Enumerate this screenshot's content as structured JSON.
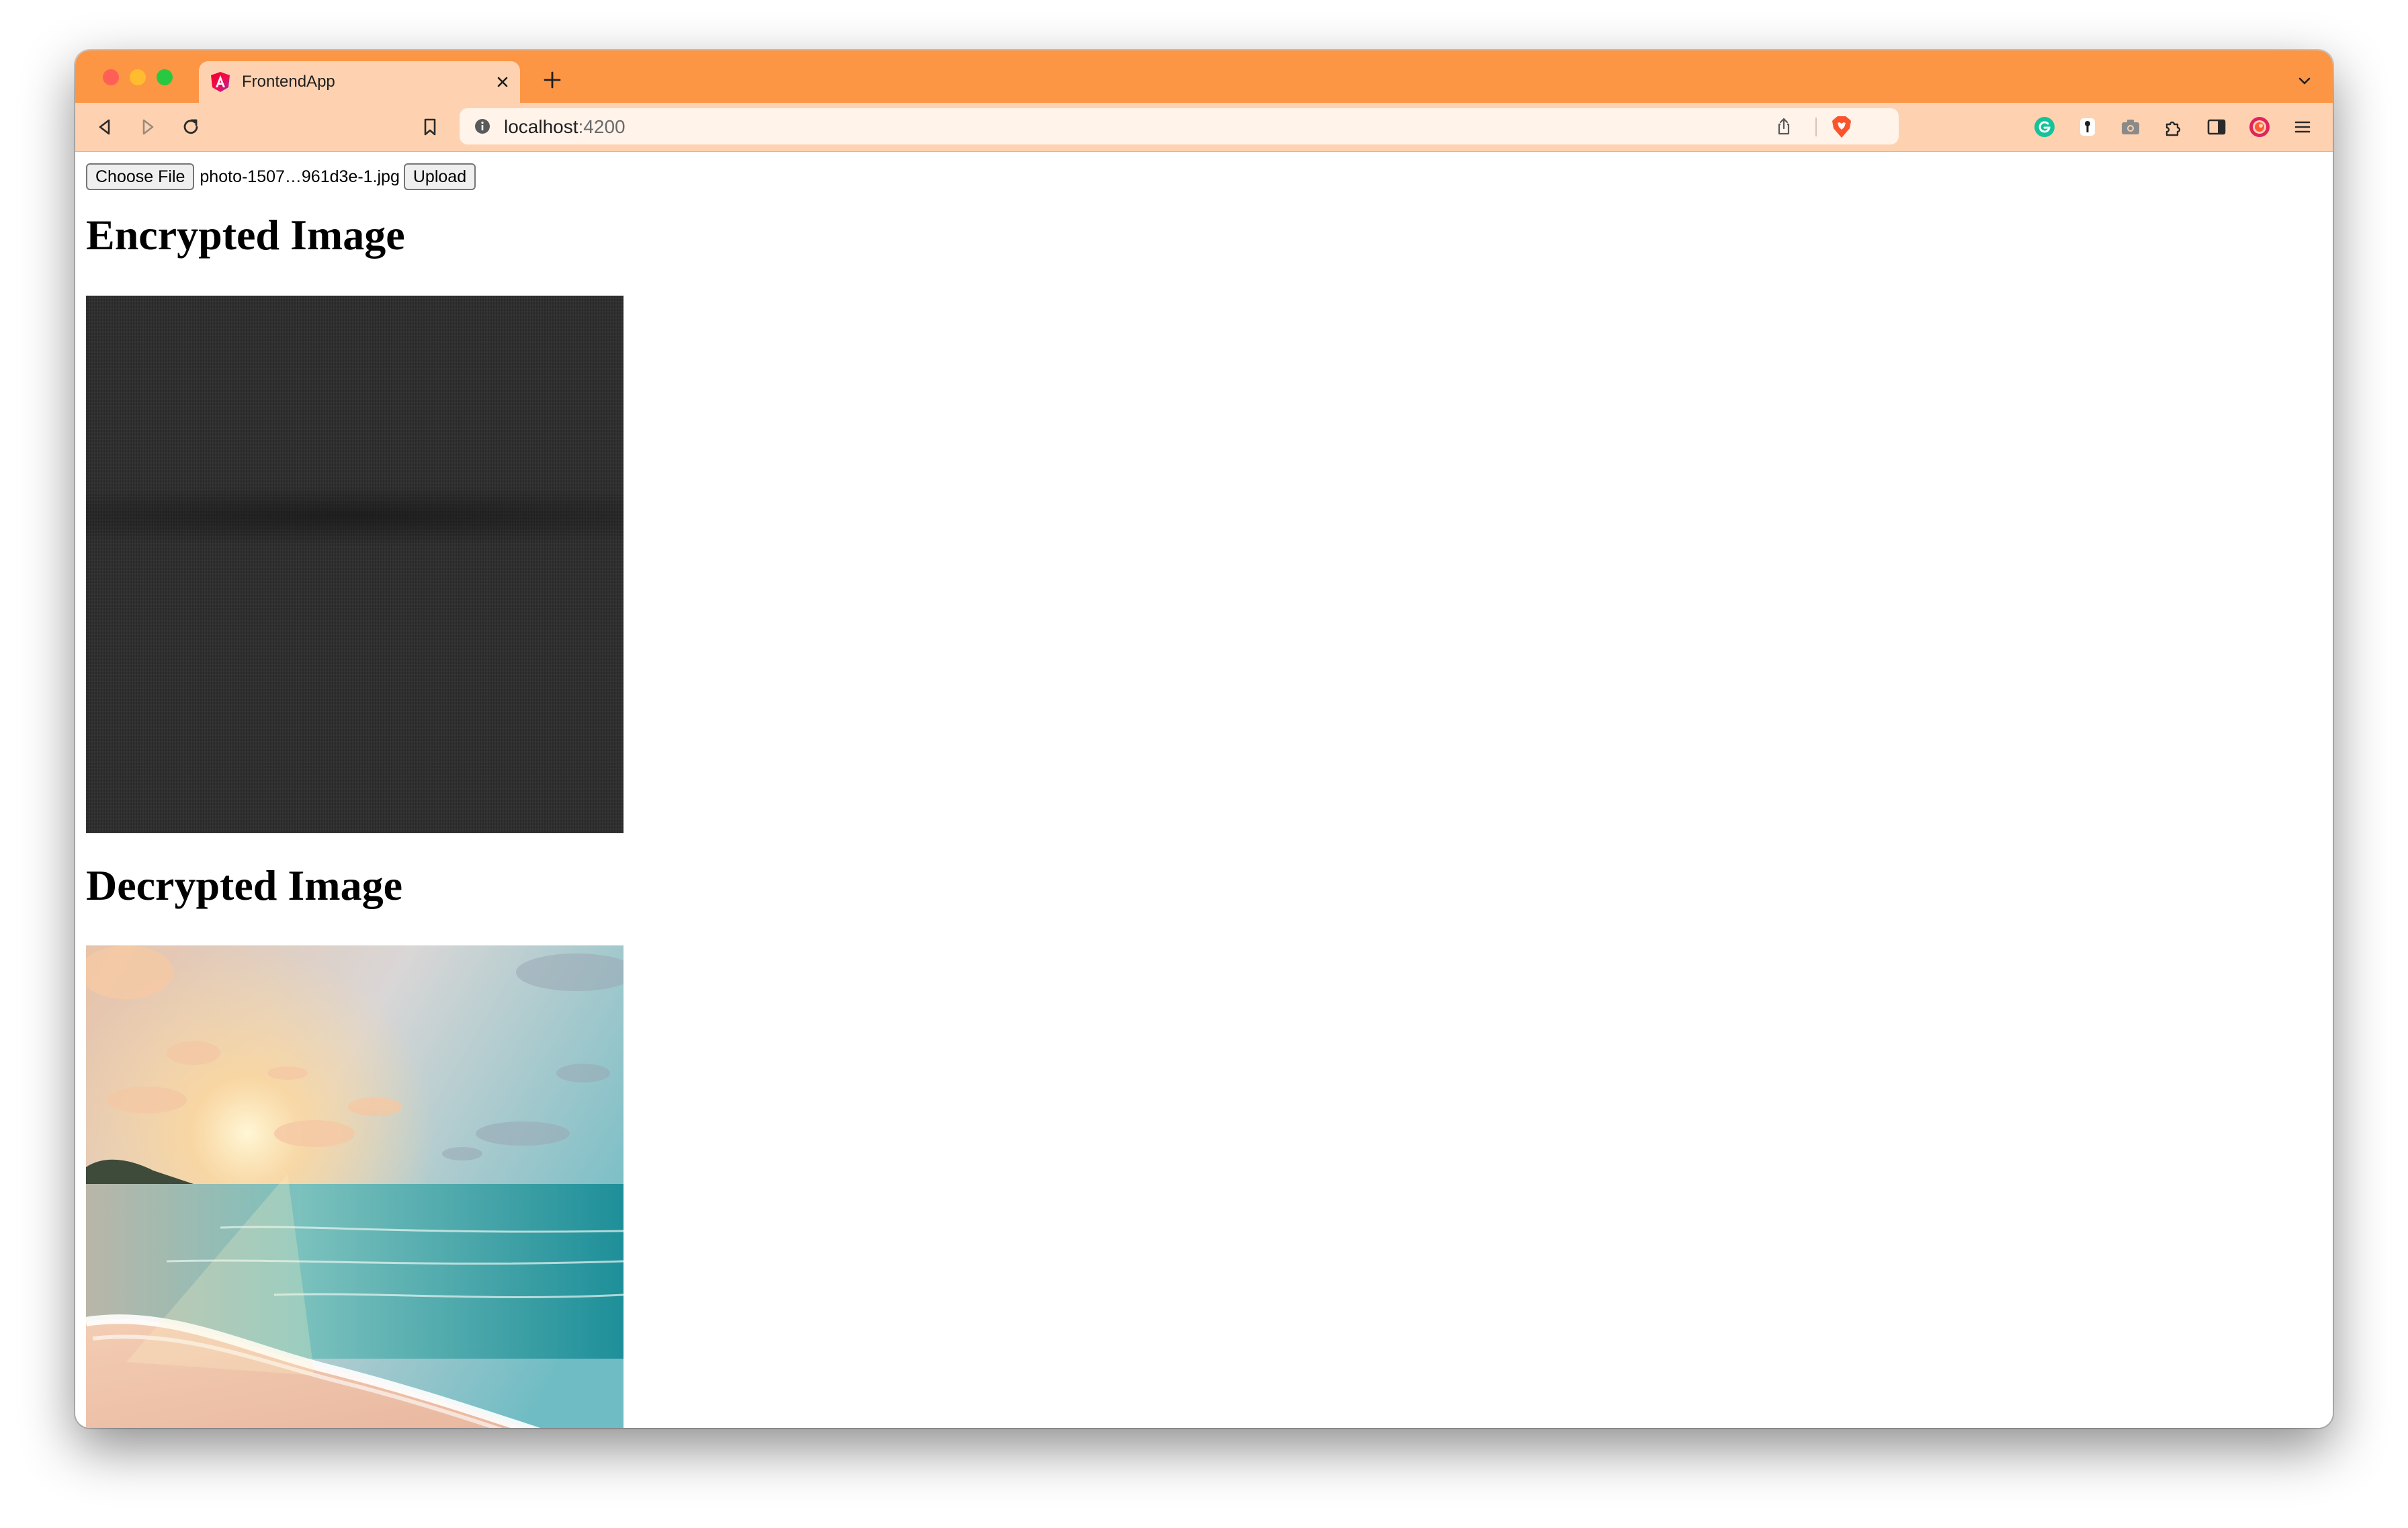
{
  "browser": {
    "tab": {
      "title": "FrontendApp",
      "favicon": "angular-logo-icon"
    },
    "address_bar": {
      "host": "localhost",
      "port": ":4200"
    },
    "toolbar_icons": [
      "back-icon",
      "forward-icon",
      "reload-icon",
      "bookmark-icon",
      "info-icon",
      "share-icon",
      "brave-shield-icon",
      "grammarly-icon",
      "password-manager-icon",
      "screenshot-icon",
      "extensions-icon",
      "sidebar-icon",
      "brave-rewards-icon",
      "menu-icon"
    ],
    "accent_color": "#fd9644",
    "toolbar_color": "#fed2b0"
  },
  "page": {
    "choose_file_label": "Choose File",
    "selected_file": "photo-1507…961d3e-1.jpg",
    "upload_label": "Upload",
    "encrypted_heading": "Encrypted Image",
    "decrypted_heading": "Decrypted Image"
  }
}
